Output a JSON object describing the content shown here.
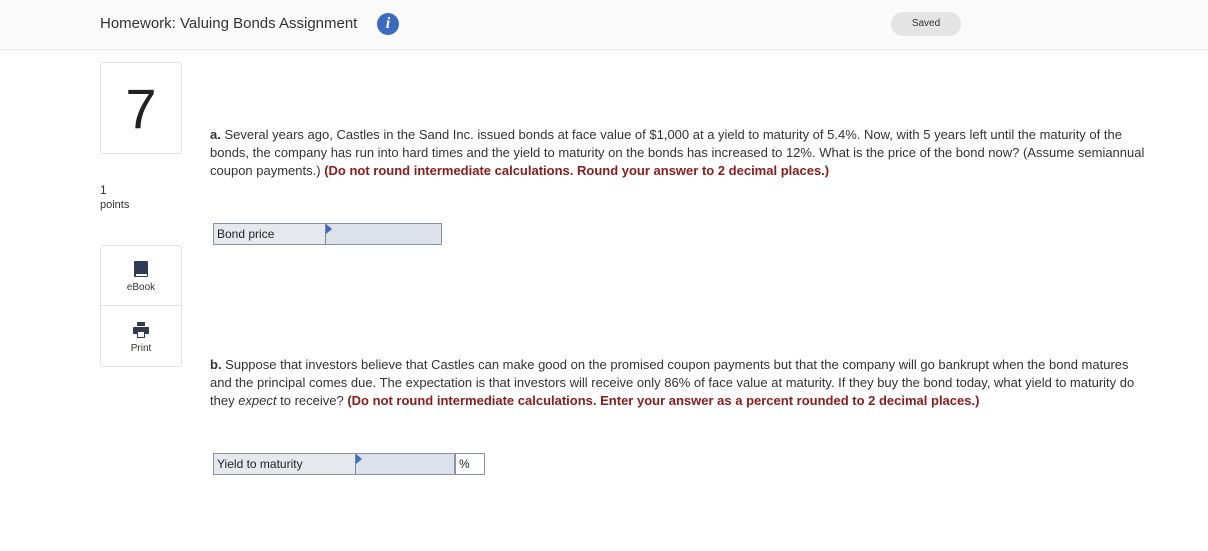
{
  "header": {
    "title": "Homework: Valuing Bonds Assignment",
    "info_icon": "i",
    "status": "Saved"
  },
  "question": {
    "number": "7",
    "points_value": "1",
    "points_label": "points"
  },
  "tools": [
    {
      "label": "eBook",
      "icon": "book-icon"
    },
    {
      "label": "Print",
      "icon": "printer-icon"
    }
  ],
  "part_a": {
    "letter": "a.",
    "text": " Several years ago, Castles in the Sand Inc. issued bonds at face value of $1,000 at a yield to maturity of 5.4%. Now, with 5 years left until the maturity of the bonds, the company has run into hard times and the yield to maturity on the bonds has increased to 12%. What is the price of the bond now? (Assume semiannual coupon payments.) ",
    "instruction": "(Do not round intermediate calculations. Round your answer to 2 decimal places.)",
    "answer_label": "Bond price",
    "answer_value": ""
  },
  "part_b": {
    "letter": "b.",
    "text_1": " Suppose that investors believe that Castles can make good on the promised coupon payments but that the company will go bankrupt when the bond matures and the principal comes due. The expectation is that investors will receive only 86% of face value at maturity. If they buy the bond today, what yield to maturity do they ",
    "text_em": "expect",
    "text_2": " to receive? ",
    "instruction": "(Do not round intermediate calculations. Enter your answer as a percent rounded to 2 decimal places.)",
    "answer_label": "Yield to maturity",
    "answer_value": "",
    "unit": "%"
  },
  "colors": {
    "accent": "#3a6bc4",
    "instruction": "#8b1a1a"
  }
}
